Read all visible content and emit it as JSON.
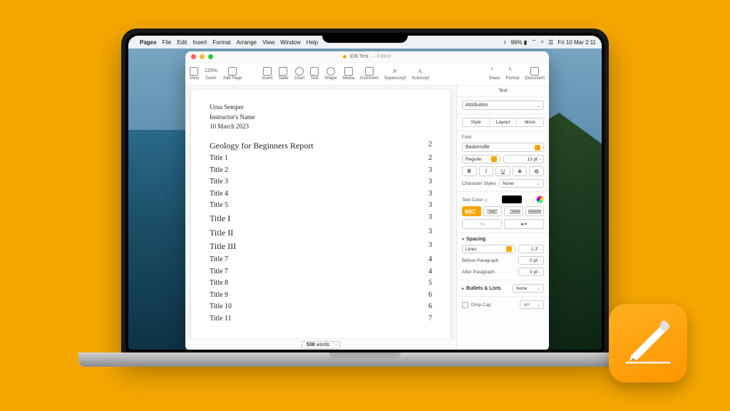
{
  "menubar": {
    "app": "Pages",
    "items": [
      "File",
      "Edit",
      "Insert",
      "Format",
      "Arrange",
      "View",
      "Window",
      "Help"
    ],
    "battery": "96%",
    "datetime": "Fri 10 Mar  2:11"
  },
  "window": {
    "title": "IDB Test",
    "subtitle": "— Edited"
  },
  "toolbar": {
    "zoom_value": "125%",
    "items": [
      "View",
      "Zoom",
      "Add Page",
      "Insert",
      "Table",
      "Chart",
      "Text",
      "Shape",
      "Media",
      "Comment",
      "Superscript",
      "Subscript"
    ],
    "right": [
      "Share",
      "Format",
      "Document"
    ]
  },
  "document": {
    "header": {
      "name": "Urna Semper",
      "instructor": "Instructor's Name",
      "date": "10 March 2023"
    },
    "toc_title": "Geology for Beginners Report",
    "toc_title_page": "2",
    "toc": [
      {
        "title": "Title 1",
        "page": "2"
      },
      {
        "title": "Title 2",
        "page": "3"
      },
      {
        "title": "Title 3",
        "page": "3"
      },
      {
        "title": "Title 4",
        "page": "3"
      },
      {
        "title": "Title 5",
        "page": "3"
      },
      {
        "title": "Title I",
        "page": "3"
      },
      {
        "title": "Title II",
        "page": "3"
      },
      {
        "title": "Title III",
        "page": "3"
      },
      {
        "title": "Title 7",
        "page": "4"
      },
      {
        "title": "Title 7",
        "page": "4"
      },
      {
        "title": "Title 8",
        "page": "5"
      },
      {
        "title": "Title 9",
        "page": "6"
      },
      {
        "title": "Title 10",
        "page": "6"
      },
      {
        "title": "Title 11",
        "page": "7"
      }
    ],
    "word_count": "538",
    "word_label": "words"
  },
  "inspector": {
    "tab": "Text",
    "paragraph_style": "Attribution",
    "segments": [
      "Style",
      "Layout",
      "More"
    ],
    "font_label": "Font",
    "font_family": "Baskerville",
    "font_style": "Regular",
    "font_size": "13 pt",
    "char_styles_label": "Character Styles",
    "char_styles_value": "None",
    "text_color_label": "Text Color",
    "spacing_label": "Spacing",
    "lines_label": "Lines",
    "lines_value": "1.3",
    "before_label": "Before Paragraph",
    "before_value": "0 pt",
    "after_label": "After Paragraph",
    "after_value": "0 pt",
    "bullets_label": "Bullets & Lists",
    "bullets_value": "None",
    "dropcap_label": "Drop Cap"
  }
}
